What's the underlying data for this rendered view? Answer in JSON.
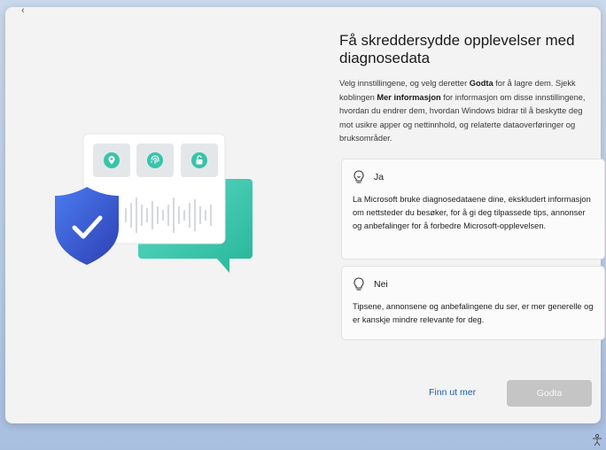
{
  "header": {
    "title": "Få skreddersydde opplevelser med diagnosedata",
    "desc_prefix": "Velg innstillingene, og velg deretter ",
    "desc_bold_1": "Godta",
    "desc_mid": " for å lagre dem. Sjekk koblingen ",
    "desc_bold_2": "Mer informasjon",
    "desc_suffix": " for informasjon om disse innstillingene, hvordan du endrer dem, hvordan Windows bidrar til å beskytte deg mot usikre apper og nettinnhold, og relaterte dataoverføringer og bruksområder."
  },
  "options": [
    {
      "label": "Ja",
      "icon": "lightbulb-icon",
      "text": "La Microsoft bruke diagnosedataene dine, ekskludert informasjon om nettsteder du besøker, for å gi deg tilpassede tips, annonser og anbefalinger for å forbedre Microsoft-opplevelsen."
    },
    {
      "label": "Nei",
      "icon": "lightbulb-off-icon",
      "text": "Tipsene, annonsene og anbefalingene du ser, er mer generelle og er kanskje mindre relevante for deg."
    }
  ],
  "footer": {
    "learn_more": "Finn ut mer",
    "accept": "Godta"
  },
  "colors": {
    "accent_link": "#1b5fb0",
    "teal": "#3dc9b0",
    "shield_blue": "#3c63d6",
    "disabled_button": "#c5c5c5"
  }
}
